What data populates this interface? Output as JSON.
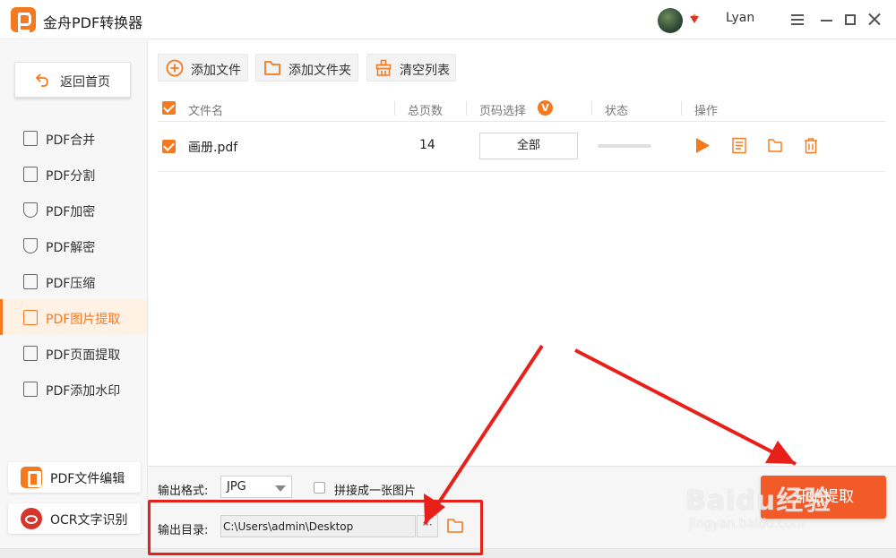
{
  "window": {
    "title": "金舟PDF转换器",
    "username": "Lyan"
  },
  "sidebar": {
    "home_label": "返回首页",
    "items": [
      {
        "label": "PDF合并",
        "icon": "merge-icon"
      },
      {
        "label": "PDF分割",
        "icon": "split-icon"
      },
      {
        "label": "PDF加密",
        "icon": "shield-plus-icon"
      },
      {
        "label": "PDF解密",
        "icon": "shield-minus-icon"
      },
      {
        "label": "PDF压缩",
        "icon": "compress-icon"
      },
      {
        "label": "PDF图片提取",
        "icon": "image-icon",
        "active": true
      },
      {
        "label": "PDF页面提取",
        "icon": "page-icon"
      },
      {
        "label": "PDF添加水印",
        "icon": "watermark-icon"
      }
    ],
    "tools": [
      {
        "label": "PDF文件编辑",
        "icon": "pdf-edit-icon"
      },
      {
        "label": "OCR文字识别",
        "icon": "ocr-eye-icon"
      }
    ]
  },
  "toolbar": {
    "add_file": "添加文件",
    "add_folder": "添加文件夹",
    "clear_list": "清空列表"
  },
  "table": {
    "headers": {
      "name": "文件名",
      "pages": "总页数",
      "page_select": "页码选择",
      "status": "状态",
      "actions": "操作"
    },
    "page_select_badge": "V",
    "rows": [
      {
        "name": "画册.pdf",
        "pages": "14",
        "page_select": "全部",
        "progress": 0,
        "checked": true
      }
    ]
  },
  "bottom": {
    "format_label": "输出格式:",
    "format_value": "JPG",
    "merge_label": "拼接成一张图片",
    "merge_checked": false,
    "dir_label": "输出目录:",
    "dir_value": "C:\\Users\\admin\\Desktop",
    "browse_label": "···",
    "start_label": "开始提取"
  },
  "watermark": {
    "text": "Baidu经验",
    "url": "jingyan.baidu.com"
  },
  "colors": {
    "accent": "#f5791f",
    "start_button": "#f25a28",
    "annotation": "#e8201a"
  }
}
